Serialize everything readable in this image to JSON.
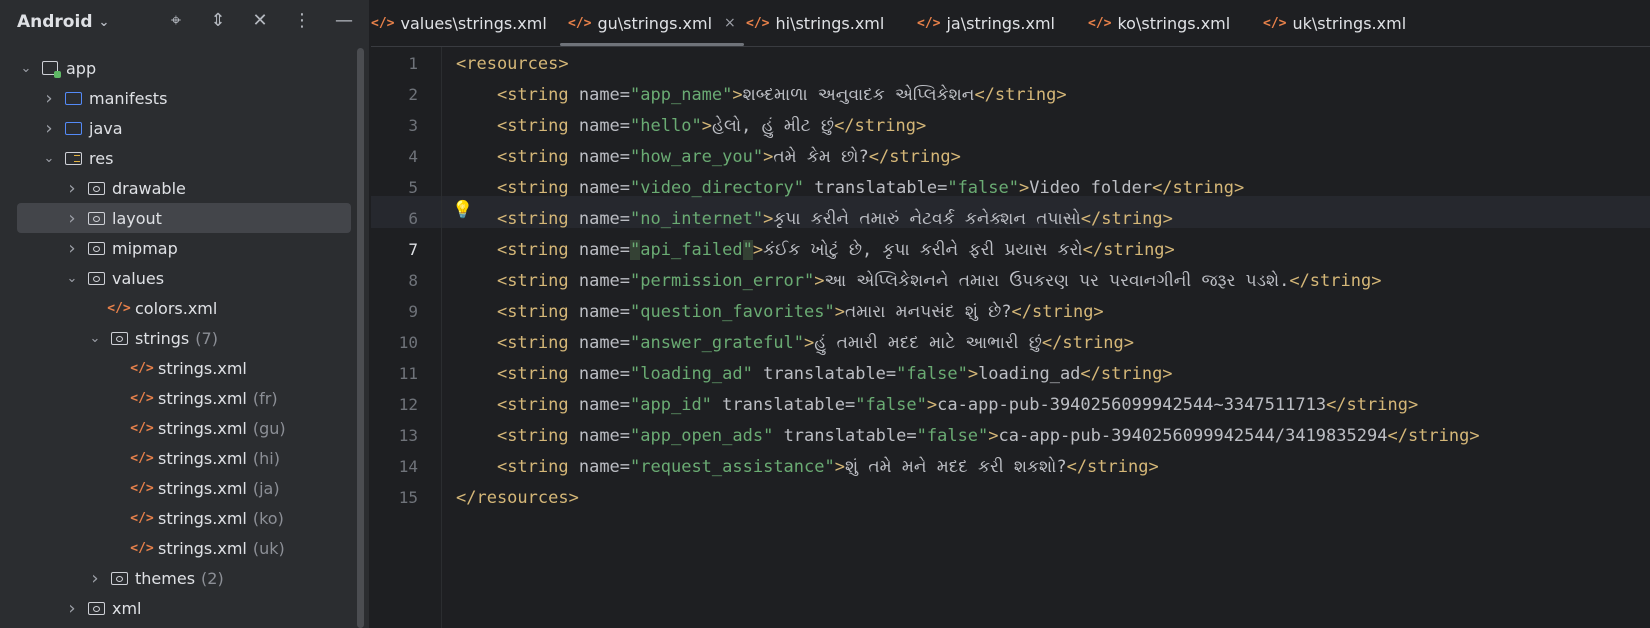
{
  "project_panel": {
    "title": "Android",
    "tools": [
      "target-icon",
      "expand-icon",
      "collapse-icon",
      "more-icon",
      "minimize-icon"
    ],
    "tree": [
      {
        "label": "app",
        "hint": "",
        "indent": 0,
        "arrow": "down",
        "icon": "module-icon"
      },
      {
        "label": "manifests",
        "hint": "",
        "indent": 1,
        "arrow": "right",
        "icon": "folder-icon"
      },
      {
        "label": "java",
        "hint": "",
        "indent": 1,
        "arrow": "right",
        "icon": "folder-icon"
      },
      {
        "label": "res",
        "hint": "",
        "indent": 1,
        "arrow": "down",
        "icon": "res-folder-icon"
      },
      {
        "label": "drawable",
        "hint": "",
        "indent": 2,
        "arrow": "right",
        "icon": "res-subfolder-icon"
      },
      {
        "label": "layout",
        "hint": "",
        "indent": 2,
        "arrow": "right",
        "icon": "res-subfolder-icon",
        "selected": true
      },
      {
        "label": "mipmap",
        "hint": "",
        "indent": 2,
        "arrow": "right",
        "icon": "res-subfolder-icon"
      },
      {
        "label": "values",
        "hint": "",
        "indent": 2,
        "arrow": "down",
        "icon": "res-subfolder-icon"
      },
      {
        "label": "colors.xml",
        "hint": "",
        "indent": 3,
        "arrow": "",
        "icon": "xml-file-icon"
      },
      {
        "label": "strings",
        "hint": "(7)",
        "indent": 3,
        "arrow": "down",
        "icon": "res-subfolder-icon"
      },
      {
        "label": "strings.xml",
        "hint": "",
        "indent": 4,
        "arrow": "",
        "icon": "xml-file-icon"
      },
      {
        "label": "strings.xml",
        "hint": "(fr)",
        "indent": 4,
        "arrow": "",
        "icon": "xml-file-icon"
      },
      {
        "label": "strings.xml",
        "hint": "(gu)",
        "indent": 4,
        "arrow": "",
        "icon": "xml-file-icon"
      },
      {
        "label": "strings.xml",
        "hint": "(hi)",
        "indent": 4,
        "arrow": "",
        "icon": "xml-file-icon"
      },
      {
        "label": "strings.xml",
        "hint": "(ja)",
        "indent": 4,
        "arrow": "",
        "icon": "xml-file-icon"
      },
      {
        "label": "strings.xml",
        "hint": "(ko)",
        "indent": 4,
        "arrow": "",
        "icon": "xml-file-icon"
      },
      {
        "label": "strings.xml",
        "hint": "(uk)",
        "indent": 4,
        "arrow": "",
        "icon": "xml-file-icon"
      },
      {
        "label": "themes",
        "hint": "(2)",
        "indent": 3,
        "arrow": "right",
        "icon": "res-subfolder-icon"
      },
      {
        "label": "xml",
        "hint": "",
        "indent": 2,
        "arrow": "right",
        "icon": "res-subfolder-icon"
      }
    ]
  },
  "tabs": [
    {
      "label": "values\\strings.xml",
      "active": false
    },
    {
      "label": "gu\\strings.xml",
      "active": true,
      "close": "×"
    },
    {
      "label": "hi\\strings.xml",
      "active": false
    },
    {
      "label": "ja\\strings.xml",
      "active": false
    },
    {
      "label": "ko\\strings.xml",
      "active": false
    },
    {
      "label": "uk\\strings.xml",
      "active": false
    }
  ],
  "editor": {
    "current_line": 7,
    "lines": [
      [
        [
          "tag",
          "<resources>"
        ]
      ],
      [
        [
          "ws",
          "    "
        ],
        [
          "tag",
          "<string "
        ],
        [
          "attr",
          "name="
        ],
        [
          "val",
          "\"app_name\""
        ],
        [
          "tag",
          ">"
        ],
        [
          "txt",
          "શબ્દમાળા અનુવાદક એપ્લિકેશન"
        ],
        [
          "tag",
          "</string>"
        ]
      ],
      [
        [
          "ws",
          "    "
        ],
        [
          "tag",
          "<string "
        ],
        [
          "attr",
          "name="
        ],
        [
          "val",
          "\"hello\""
        ],
        [
          "tag",
          ">"
        ],
        [
          "txt",
          "હેલો, હું મીટ છું"
        ],
        [
          "tag",
          "</string>"
        ]
      ],
      [
        [
          "ws",
          "    "
        ],
        [
          "tag",
          "<string "
        ],
        [
          "attr",
          "name="
        ],
        [
          "val",
          "\"how_are_you\""
        ],
        [
          "tag",
          ">"
        ],
        [
          "txt",
          "તમે કેમ છો?"
        ],
        [
          "tag",
          "</string>"
        ]
      ],
      [
        [
          "ws",
          "    "
        ],
        [
          "tag",
          "<string "
        ],
        [
          "attr",
          "name="
        ],
        [
          "val",
          "\"video_directory\""
        ],
        [
          "attr",
          " translatable="
        ],
        [
          "val",
          "\"false\""
        ],
        [
          "tag",
          ">"
        ],
        [
          "txt",
          "Video folder"
        ],
        [
          "tag",
          "</string>"
        ]
      ],
      [
        [
          "ws",
          "    "
        ],
        [
          "tag",
          "<string "
        ],
        [
          "attr",
          "name="
        ],
        [
          "val",
          "\"no_internet\""
        ],
        [
          "tag",
          ">"
        ],
        [
          "txt",
          "કૃપા કરીને તમારું નેટવર્ક કનેક્શન તપાસો"
        ],
        [
          "tag",
          "</string>"
        ]
      ],
      [
        [
          "ws",
          "    "
        ],
        [
          "tag",
          "<string "
        ],
        [
          "attr",
          "name="
        ],
        [
          "valhl",
          "\""
        ],
        [
          "val",
          "api_failed"
        ],
        [
          "valhl",
          "\""
        ],
        [
          "tag",
          ">"
        ],
        [
          "txt",
          "કંઈક ખોટું છે, કૃપા કરીને ફરી પ્રયાસ કરો"
        ],
        [
          "tag",
          "</string>"
        ]
      ],
      [
        [
          "ws",
          "    "
        ],
        [
          "tag",
          "<string "
        ],
        [
          "attr",
          "name="
        ],
        [
          "val",
          "\"permission_error\""
        ],
        [
          "tag",
          ">"
        ],
        [
          "txt",
          "આ એપ્લિકેશનને તમારા ઉપકરણ પર પરવાનગીની જરૂર પડશે."
        ],
        [
          "tag",
          "</string>"
        ]
      ],
      [
        [
          "ws",
          "    "
        ],
        [
          "tag",
          "<string "
        ],
        [
          "attr",
          "name="
        ],
        [
          "val",
          "\"question_favorites\""
        ],
        [
          "tag",
          ">"
        ],
        [
          "txt",
          "તમારા મનપસંદ શું છે?"
        ],
        [
          "tag",
          "</string>"
        ]
      ],
      [
        [
          "ws",
          "    "
        ],
        [
          "tag",
          "<string "
        ],
        [
          "attr",
          "name="
        ],
        [
          "val",
          "\"answer_grateful\""
        ],
        [
          "tag",
          ">"
        ],
        [
          "txt",
          "હું તમારી મદદ માટે આભારી છું"
        ],
        [
          "tag",
          "</string>"
        ]
      ],
      [
        [
          "ws",
          "    "
        ],
        [
          "tag",
          "<string "
        ],
        [
          "attr",
          "name="
        ],
        [
          "val",
          "\"loading_ad\""
        ],
        [
          "attr",
          " translatable="
        ],
        [
          "val",
          "\"false\""
        ],
        [
          "tag",
          ">"
        ],
        [
          "txt",
          "loading_ad"
        ],
        [
          "tag",
          "</string>"
        ]
      ],
      [
        [
          "ws",
          "    "
        ],
        [
          "tag",
          "<string "
        ],
        [
          "attr",
          "name="
        ],
        [
          "val",
          "\"app_id\""
        ],
        [
          "attr",
          " translatable="
        ],
        [
          "val",
          "\"false\""
        ],
        [
          "tag",
          ">"
        ],
        [
          "txt",
          "ca-app-pub-3940256099942544~3347511713"
        ],
        [
          "tag",
          "</string>"
        ]
      ],
      [
        [
          "ws",
          "    "
        ],
        [
          "tag",
          "<string "
        ],
        [
          "attr",
          "name="
        ],
        [
          "val",
          "\"app_open_ads\""
        ],
        [
          "attr",
          " translatable="
        ],
        [
          "val",
          "\"false\""
        ],
        [
          "tag",
          ">"
        ],
        [
          "txt",
          "ca-app-pub-3940256099942544/3419835294"
        ],
        [
          "tag",
          "</string>"
        ]
      ],
      [
        [
          "ws",
          "    "
        ],
        [
          "tag",
          "<string "
        ],
        [
          "attr",
          "name="
        ],
        [
          "val",
          "\"request_assistance\""
        ],
        [
          "tag",
          ">"
        ],
        [
          "txt",
          "શું તમે મને મદદ કરી શકશો?"
        ],
        [
          "tag",
          "</string>"
        ]
      ],
      [
        [
          "tag",
          "</resources>"
        ]
      ]
    ]
  }
}
